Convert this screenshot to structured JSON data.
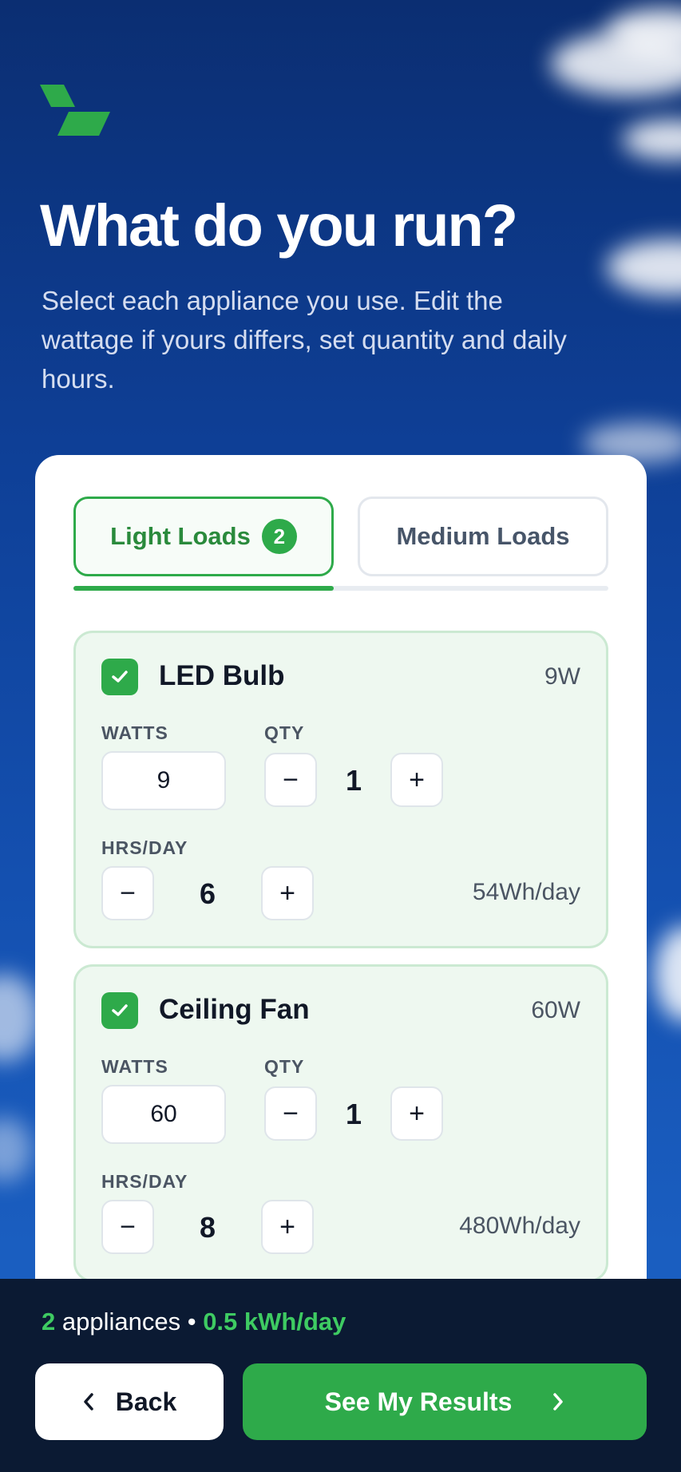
{
  "header": {
    "title": "What do you run?",
    "subtitle": "Select each appliance you use. Edit the wattage if yours differs, set quantity and daily hours."
  },
  "tabs": [
    {
      "label": "Light Loads",
      "badge": "2",
      "active": true
    },
    {
      "label": "Medium Loads",
      "active": false
    }
  ],
  "labels": {
    "watts": "WATTS",
    "qty": "QTY",
    "hrs": "HRS/DAY"
  },
  "appliances": [
    {
      "name": "LED Bulb",
      "watt_tag": "9W",
      "watts": "9",
      "qty": "1",
      "hours": "6",
      "wh_per_day": "54Wh/day",
      "checked": true
    },
    {
      "name": "Ceiling Fan",
      "watt_tag": "60W",
      "watts": "60",
      "qty": "1",
      "hours": "8",
      "wh_per_day": "480Wh/day",
      "checked": true
    }
  ],
  "stepper": {
    "minus": "−",
    "plus": "+"
  },
  "footer": {
    "count": "2",
    "count_suffix": " appliances",
    "separator": " • ",
    "energy": "0.5 kWh/day",
    "back_label": "Back",
    "results_label": "See My Results"
  },
  "colors": {
    "accent": "#2eaa4a",
    "sky": "#0e3f96",
    "footer_bg": "#0b1a33",
    "card_bg": "#eef8f0"
  }
}
